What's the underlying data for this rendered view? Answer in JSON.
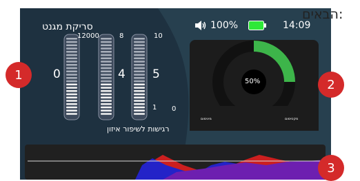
{
  "header": {
    "title": "סריקת מגנט",
    "volume_icon": "speaker-icon",
    "battery_percent": "100%",
    "battery_icon": "battery-full-icon",
    "time": "14:09"
  },
  "overflow_text": "הבאים:",
  "bars": {
    "top_labels": [
      "12000",
      "8",
      "10"
    ],
    "values": [
      "0",
      "4",
      "5"
    ],
    "bottom_labels": [
      "1",
      "0"
    ],
    "caption": "רגישות לשיפור איזון"
  },
  "gauge": {
    "percent_label": "50%",
    "percent": 50,
    "label_left": "מינימום",
    "label_right": "מקסימום",
    "colors": {
      "fill": "#3db54a",
      "track": "#111111",
      "bg": "#1c1c1c"
    }
  },
  "markers": [
    "1",
    "2",
    "3"
  ],
  "colors": {
    "screen_bg": "#1e3140",
    "marker": "#d42a2a",
    "battery": "#2ee838",
    "graph_red": "#cc1f1f",
    "graph_blue": "#2323c8",
    "graph_purple": "#6d1fb0"
  }
}
